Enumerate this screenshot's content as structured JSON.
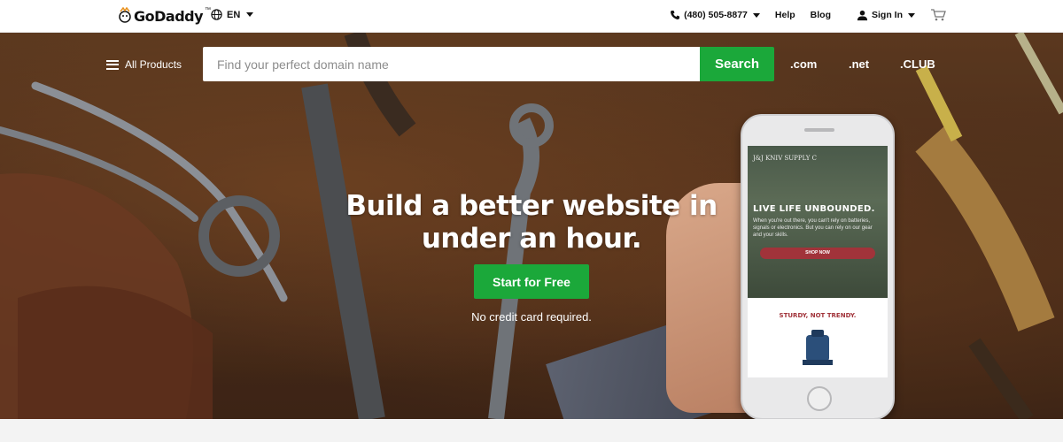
{
  "topbar": {
    "logo_text": "GoDaddy",
    "logo_tm": "™",
    "language": "EN",
    "phone": "(480) 505-8877",
    "help": "Help",
    "blog": "Blog",
    "sign_in": "Sign In"
  },
  "hero": {
    "all_products": "All Products",
    "search_placeholder": "Find your perfect domain name",
    "search_button": "Search",
    "tlds": [
      ".com",
      ".net",
      ".CLUB"
    ],
    "headline_line1": "Build a better website in",
    "headline_line2": "under an hour.",
    "cta": "Start for Free",
    "subtext": "No credit card required."
  },
  "phone_screen": {
    "brand": "J&J KNIV   SUPPLY C",
    "title": "LIVE LIFE UNBOUNDED.",
    "body": "When you're out there, you can't rely on batteries, signals or electronics. But you can rely on our gear and your skills.",
    "button": "SHOP NOW",
    "tagline": "STURDY, NOT TRENDY."
  },
  "colors": {
    "accent_green": "#1ba83a",
    "brand_text": "#111111"
  },
  "icons": [
    "globe-icon",
    "phone-icon",
    "user-icon",
    "cart-icon",
    "menu-icon"
  ]
}
